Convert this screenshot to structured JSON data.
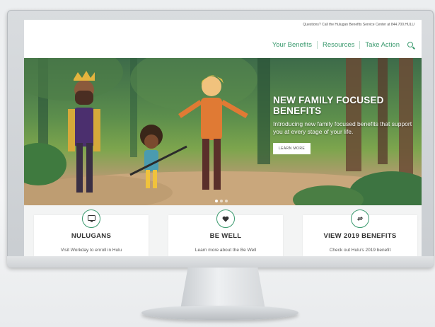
{
  "topbar": {
    "text": "Questions? Call the Hulugan Benefits Service Center at 844.700.HULU"
  },
  "nav": {
    "items": [
      "Your Benefits",
      "Resources",
      "Take Action"
    ]
  },
  "hero": {
    "title": "NEW FAMILY FOCUSED BENEFITS",
    "subtitle": "Introducing new family focused benefits that support you at every stage of your life.",
    "button": "LEARN MORE"
  },
  "cards": [
    {
      "icon": "monitor-icon",
      "title": "NULUGANS",
      "desc": "Visit Workday to enroll in Hulu"
    },
    {
      "icon": "heart-icon",
      "title": "BE WELL",
      "desc": "Learn more about the Be Well"
    },
    {
      "icon": "refresh-icon",
      "title": "VIEW 2019 BENEFITS",
      "desc": "Check out Hulu's 2019 benefit"
    }
  ],
  "colors": {
    "accent": "#3a9a6e"
  }
}
